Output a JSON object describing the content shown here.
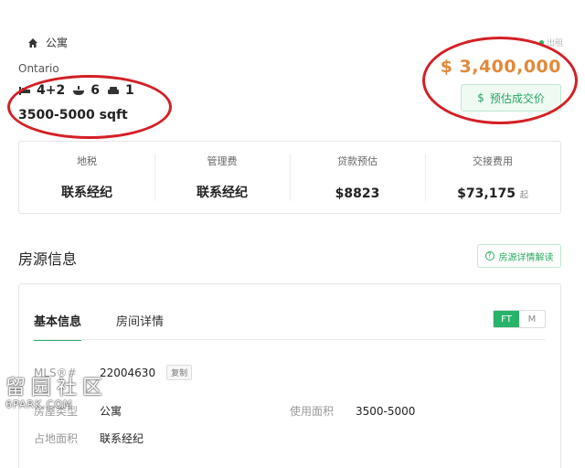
{
  "listing": {
    "property_type": "公寓",
    "status_text": "出租",
    "region": "Ontario",
    "bedrooms": "4+2",
    "bathrooms": "6",
    "parking": "1",
    "area": "3500-5000 sqft",
    "price": "$ 3,400,000",
    "estimate_label": "预估成交价"
  },
  "fees": [
    {
      "label": "地税",
      "value": "联系经纪",
      "suffix": ""
    },
    {
      "label": "管理费",
      "value": "联系经纪",
      "suffix": ""
    },
    {
      "label": "贷款预估",
      "value": "$8823",
      "suffix": ""
    },
    {
      "label": "交接费用",
      "value": "$73,175",
      "suffix": "起"
    }
  ],
  "info": {
    "section_title": "房源信息",
    "explain_label": "房源详情解读",
    "tabs": [
      {
        "label": "基本信息"
      },
      {
        "label": "房间详情"
      }
    ],
    "units": [
      "FT",
      "M"
    ],
    "rows": {
      "mls_label": "MLS®#",
      "mls_value": "22004630",
      "copy_label": "复制",
      "type_label": "房屋类型",
      "type_value": "公寓",
      "usable_label": "使用面积",
      "usable_value": "3500-5000",
      "lot_label": "占地面积",
      "lot_value": "联系经纪"
    }
  },
  "watermark": {
    "main": "留园社区",
    "sub": "6PARK.COM"
  },
  "colors": {
    "accent_green": "#27b36a",
    "price_orange": "#e08a3c",
    "annotation_red": "#d41f26"
  }
}
